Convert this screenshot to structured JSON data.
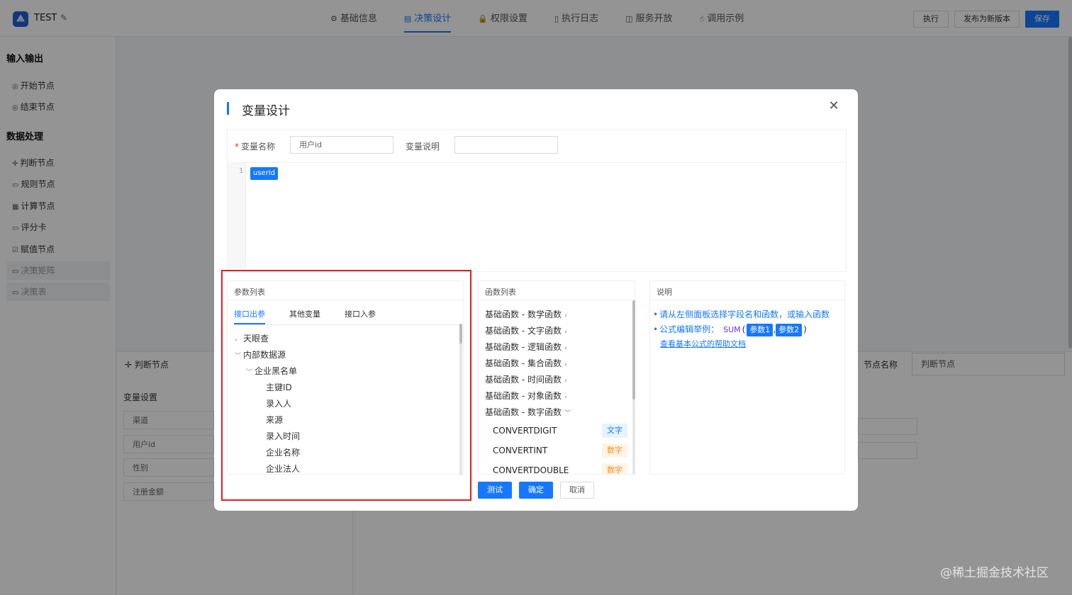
{
  "app": {
    "name": "TEST",
    "logo_icon": "logo-icon"
  },
  "tabs": [
    {
      "label": "基础信息",
      "icon": "gear-icon",
      "glyph": "⚙",
      "active": false
    },
    {
      "label": "决策设计",
      "icon": "diagram-icon",
      "glyph": "▤",
      "active": true
    },
    {
      "label": "权限设置",
      "icon": "lock-icon",
      "glyph": "🔒",
      "active": false
    },
    {
      "label": "执行日志",
      "icon": "document-icon",
      "glyph": "▯",
      "active": false
    },
    {
      "label": "服务开放",
      "icon": "book-icon",
      "glyph": "◫",
      "active": false
    },
    {
      "label": "调用示例",
      "icon": "pointer-icon",
      "glyph": "☝",
      "active": false
    }
  ],
  "toolbar": {
    "run": "执行",
    "publish": "发布为新版本",
    "save": "保存"
  },
  "sidebar": {
    "groups": [
      {
        "title": "输入输出",
        "items": [
          {
            "label": "开始节点",
            "icon": "play-circle-icon",
            "glyph": "◎",
            "dim": false
          },
          {
            "label": "结束节点",
            "icon": "stop-circle-icon",
            "glyph": "◎",
            "dim": false
          }
        ]
      },
      {
        "title": "数据处理",
        "items": [
          {
            "label": "判断节点",
            "icon": "branch-icon",
            "glyph": "✛",
            "dim": false
          },
          {
            "label": "规则节点",
            "icon": "rule-icon",
            "glyph": "▭",
            "dim": false
          },
          {
            "label": "计算节点",
            "icon": "calculator-icon",
            "glyph": "▦",
            "dim": false
          },
          {
            "label": "评分卡",
            "icon": "card-icon",
            "glyph": "▭",
            "dim": false
          },
          {
            "label": "赋值节点",
            "icon": "edit-icon",
            "glyph": "☑",
            "dim": false
          },
          {
            "label": "决策矩阵",
            "icon": "matrix-icon",
            "glyph": "▭",
            "dim": true
          },
          {
            "label": "决策表",
            "icon": "table-icon",
            "glyph": "▭",
            "dim": true
          }
        ]
      }
    ]
  },
  "background": {
    "node_title": "判断节点",
    "var_section": "变量设置",
    "fields": [
      "渠道",
      "用户id",
      "性别",
      "注册金额"
    ],
    "node_name_label": "节点名称",
    "node_name_value": "判断节点"
  },
  "modal": {
    "title": "变量设计",
    "var_name_label": "变量名称",
    "var_name_value": "用户id",
    "var_desc_label": "变量说明",
    "var_desc_value": "",
    "editor_line": "1",
    "editor_token": "userId",
    "params": {
      "title": "参数列表",
      "tabs": [
        {
          "label": "接口出参",
          "active": true
        },
        {
          "label": "其他变量",
          "active": false
        },
        {
          "label": "接口入参",
          "active": false
        }
      ],
      "tree": [
        {
          "label": "天眼查",
          "level": 0,
          "expanded": false,
          "has_children": true
        },
        {
          "label": "内部数据源",
          "level": 0,
          "expanded": true,
          "has_children": true
        },
        {
          "label": "企业黑名单",
          "level": 1,
          "expanded": true,
          "has_children": true
        },
        {
          "label": "主键ID",
          "level": 2,
          "expanded": false,
          "has_children": false
        },
        {
          "label": "录入人",
          "level": 2,
          "expanded": false,
          "has_children": false
        },
        {
          "label": "来源",
          "level": 2,
          "expanded": false,
          "has_children": false
        },
        {
          "label": "录入时间",
          "level": 2,
          "expanded": false,
          "has_children": false
        },
        {
          "label": "企业名称",
          "level": 2,
          "expanded": false,
          "has_children": false
        },
        {
          "label": "企业法人",
          "level": 2,
          "expanded": false,
          "has_children": false
        }
      ]
    },
    "functions": {
      "title": "函数列表",
      "categories": [
        {
          "label": "基础函数 - 数学函数",
          "expanded": false
        },
        {
          "label": "基础函数 - 文字函数",
          "expanded": false
        },
        {
          "label": "基础函数 - 逻辑函数",
          "expanded": false
        },
        {
          "label": "基础函数 - 集合函数",
          "expanded": false
        },
        {
          "label": "基础函数 - 时间函数",
          "expanded": false
        },
        {
          "label": "基础函数 - 对象函数",
          "expanded": false
        },
        {
          "label": "基础函数 - 数字函数",
          "expanded": true
        }
      ],
      "items": [
        {
          "name": "CONVERTDIGIT",
          "tag": "文字",
          "tag_type": "text"
        },
        {
          "name": "CONVERTINT",
          "tag": "数字",
          "tag_type": "num"
        },
        {
          "name": "CONVERTDOUBLE",
          "tag": "数字",
          "tag_type": "num"
        }
      ]
    },
    "help": {
      "title": "说明",
      "line1": "请从左侧面板选择字段名和函数，或输入函数",
      "line2_prefix": "公式编辑举例：",
      "sum": "SUM",
      "open_paren": "(",
      "arg1": "参数1",
      "comma": ",",
      "arg2": "参数2",
      "close_paren": ")",
      "link": "查看基本公式的帮助文档"
    },
    "buttons": {
      "test": "测试",
      "ok": "确定",
      "cancel": "取消"
    }
  },
  "watermark": "@稀土掘金技术社区",
  "colors": {
    "primary": "#1677ff",
    "highlight": "#e02020"
  }
}
